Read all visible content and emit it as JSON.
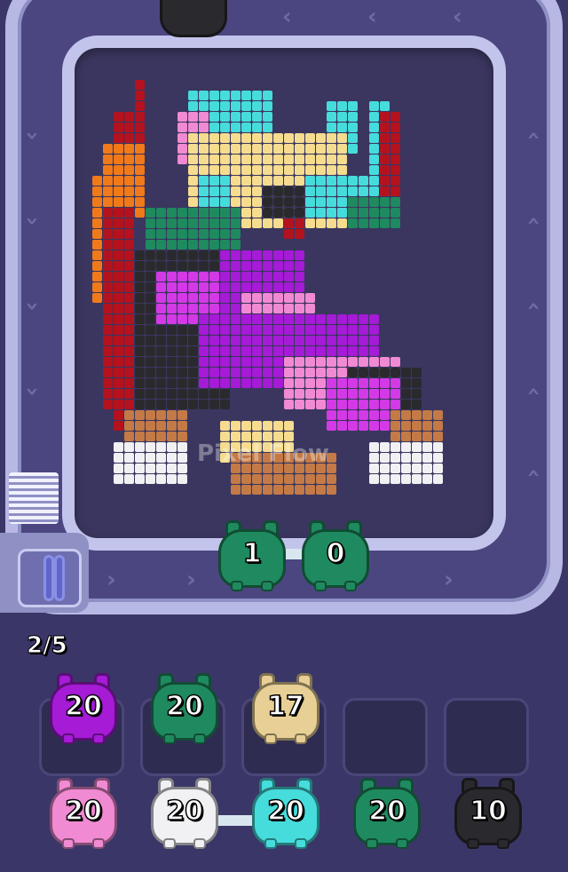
{
  "level": {
    "progress_text": "2/5"
  },
  "palette": {
    "purple": "#a51bd6",
    "green": "#1f8a5f",
    "tan": "#e8cf95",
    "pink": "#f08ad2",
    "white": "#f1f1f4",
    "cyan": "#46dcdc",
    "black": "#2a2a2e",
    "darkred": "#b3121e",
    "orange": "#f07a1a",
    "brown": "#c47a46",
    "yellow": "#f5dc8f",
    "magenta": "#d33ae6"
  },
  "on_track": [
    {
      "color": "green",
      "value": "1"
    },
    {
      "color": "green",
      "value": "0"
    }
  ],
  "queue_top_pig": {
    "color": "black"
  },
  "waiting_slots": [
    {
      "color": "purple",
      "value": "20"
    },
    {
      "color": "green",
      "value": "20"
    },
    {
      "color": "tan",
      "value": "17"
    },
    {
      "empty": true
    },
    {
      "empty": true
    }
  ],
  "bottom_row": [
    {
      "color": "pink",
      "value": "20"
    },
    {
      "color": "white",
      "value": "20"
    },
    {
      "color": "cyan",
      "value": "20"
    },
    {
      "color": "green",
      "value": "20"
    },
    {
      "color": "black",
      "value": "10"
    }
  ],
  "watermark": "Pixel Flow"
}
